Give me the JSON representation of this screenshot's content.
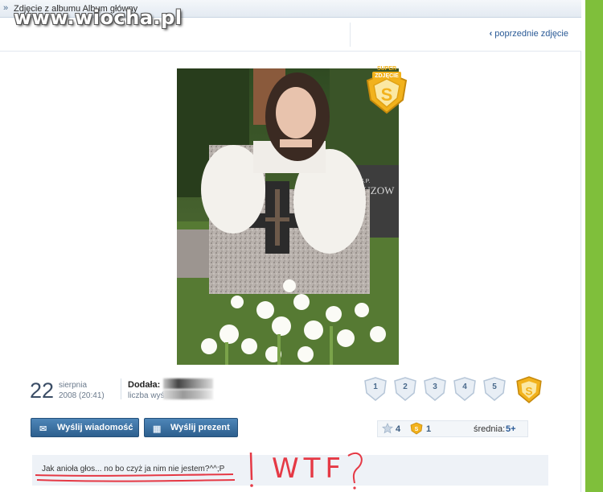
{
  "header": {
    "title": "Zdjęcie z albumu Album główny",
    "watermark": "www.wiocha.pl"
  },
  "nav": {
    "previous_link": "poprzednie zdjęcie"
  },
  "photo": {
    "super_badge": {
      "top_text": "SUPER",
      "middle_text": "ZDJĘCIE"
    }
  },
  "meta": {
    "day": "22",
    "month": "sierpnia",
    "datetime": "2008 (20:41)",
    "added_by_label": "Dodała:",
    "views_label": "liczba wyś"
  },
  "ratings": [
    "1",
    "2",
    "3",
    "4",
    "5"
  ],
  "actions": {
    "send_message": "Wyślij wiadomość",
    "send_gift": "Wyślij prezent"
  },
  "stats": {
    "stars_count": "4",
    "super_count": "1",
    "average_label": "średnia:",
    "average_value": "5+"
  },
  "caption": "Jak anioła głos... no bo czyż ja nim nie jestem?^^;P",
  "annotation": "WTF",
  "colors": {
    "accent_blue": "#2a5a96",
    "green_bar": "#7fbf3b",
    "badge_gold": "#f2b21c",
    "annotation_red": "#e53945"
  }
}
